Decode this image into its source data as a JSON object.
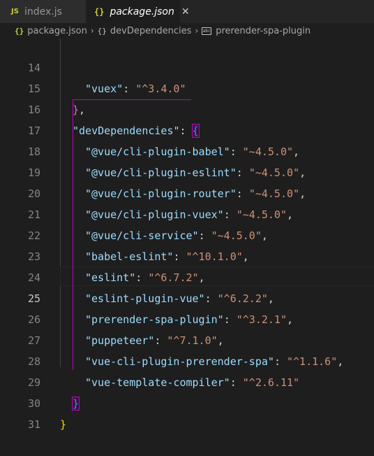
{
  "tabs": [
    {
      "icon": "JS",
      "label": "index.js",
      "active": false
    },
    {
      "icon": "{}",
      "label": "package.json",
      "active": true,
      "close": "✕"
    }
  ],
  "breadcrumb": {
    "items": [
      {
        "icon": "{}",
        "label": "package.json"
      },
      {
        "icon": "{}",
        "label": "devDependencies"
      },
      {
        "icon": "abc",
        "label": "prerender-spa-plugin"
      }
    ],
    "separator": "›"
  },
  "editor": {
    "active_line": 25,
    "lines": [
      {
        "n": "14",
        "key": "\"vuex\"",
        "val": "\"^3.4.0\""
      },
      {
        "n": "15",
        "text": "},"
      },
      {
        "n": "16",
        "key": "\"devDependencies\"",
        "brace": "{"
      },
      {
        "n": "17",
        "key": "\"@vue/cli-plugin-babel\"",
        "val": "\"~4.5.0\""
      },
      {
        "n": "18",
        "key": "\"@vue/cli-plugin-eslint\"",
        "val": "\"~4.5.0\""
      },
      {
        "n": "19",
        "key": "\"@vue/cli-plugin-router\"",
        "val": "\"~4.5.0\""
      },
      {
        "n": "20",
        "key": "\"@vue/cli-plugin-vuex\"",
        "val": "\"~4.5.0\""
      },
      {
        "n": "21",
        "key": "\"@vue/cli-service\"",
        "val": "\"~4.5.0\""
      },
      {
        "n": "22",
        "key": "\"babel-eslint\"",
        "val": "\"^10.1.0\""
      },
      {
        "n": "23",
        "key": "\"eslint\"",
        "val": "\"^6.7.2\""
      },
      {
        "n": "24",
        "key": "\"eslint-plugin-vue\"",
        "val": "\"^6.2.2\""
      },
      {
        "n": "25",
        "key": "\"prerender-spa-plugin\"",
        "val": "\"^3.2.1\""
      },
      {
        "n": "26",
        "key": "\"puppeteer\"",
        "val": "\"^7.1.0\""
      },
      {
        "n": "27",
        "key": "\"vue-cli-plugin-prerender-spa\"",
        "val": "\"^1.1.6\""
      },
      {
        "n": "28",
        "key": "\"vue-template-compiler\"",
        "val": "\"^2.6.11\""
      },
      {
        "n": "29",
        "text": "}"
      },
      {
        "n": "30",
        "text": "}"
      },
      {
        "n": "31",
        "text": ""
      }
    ]
  },
  "colors": {
    "background": "#1e1e1e",
    "key": "#9cdcfe",
    "string": "#ce9178",
    "bracket_match_outline": "#c000c0"
  }
}
